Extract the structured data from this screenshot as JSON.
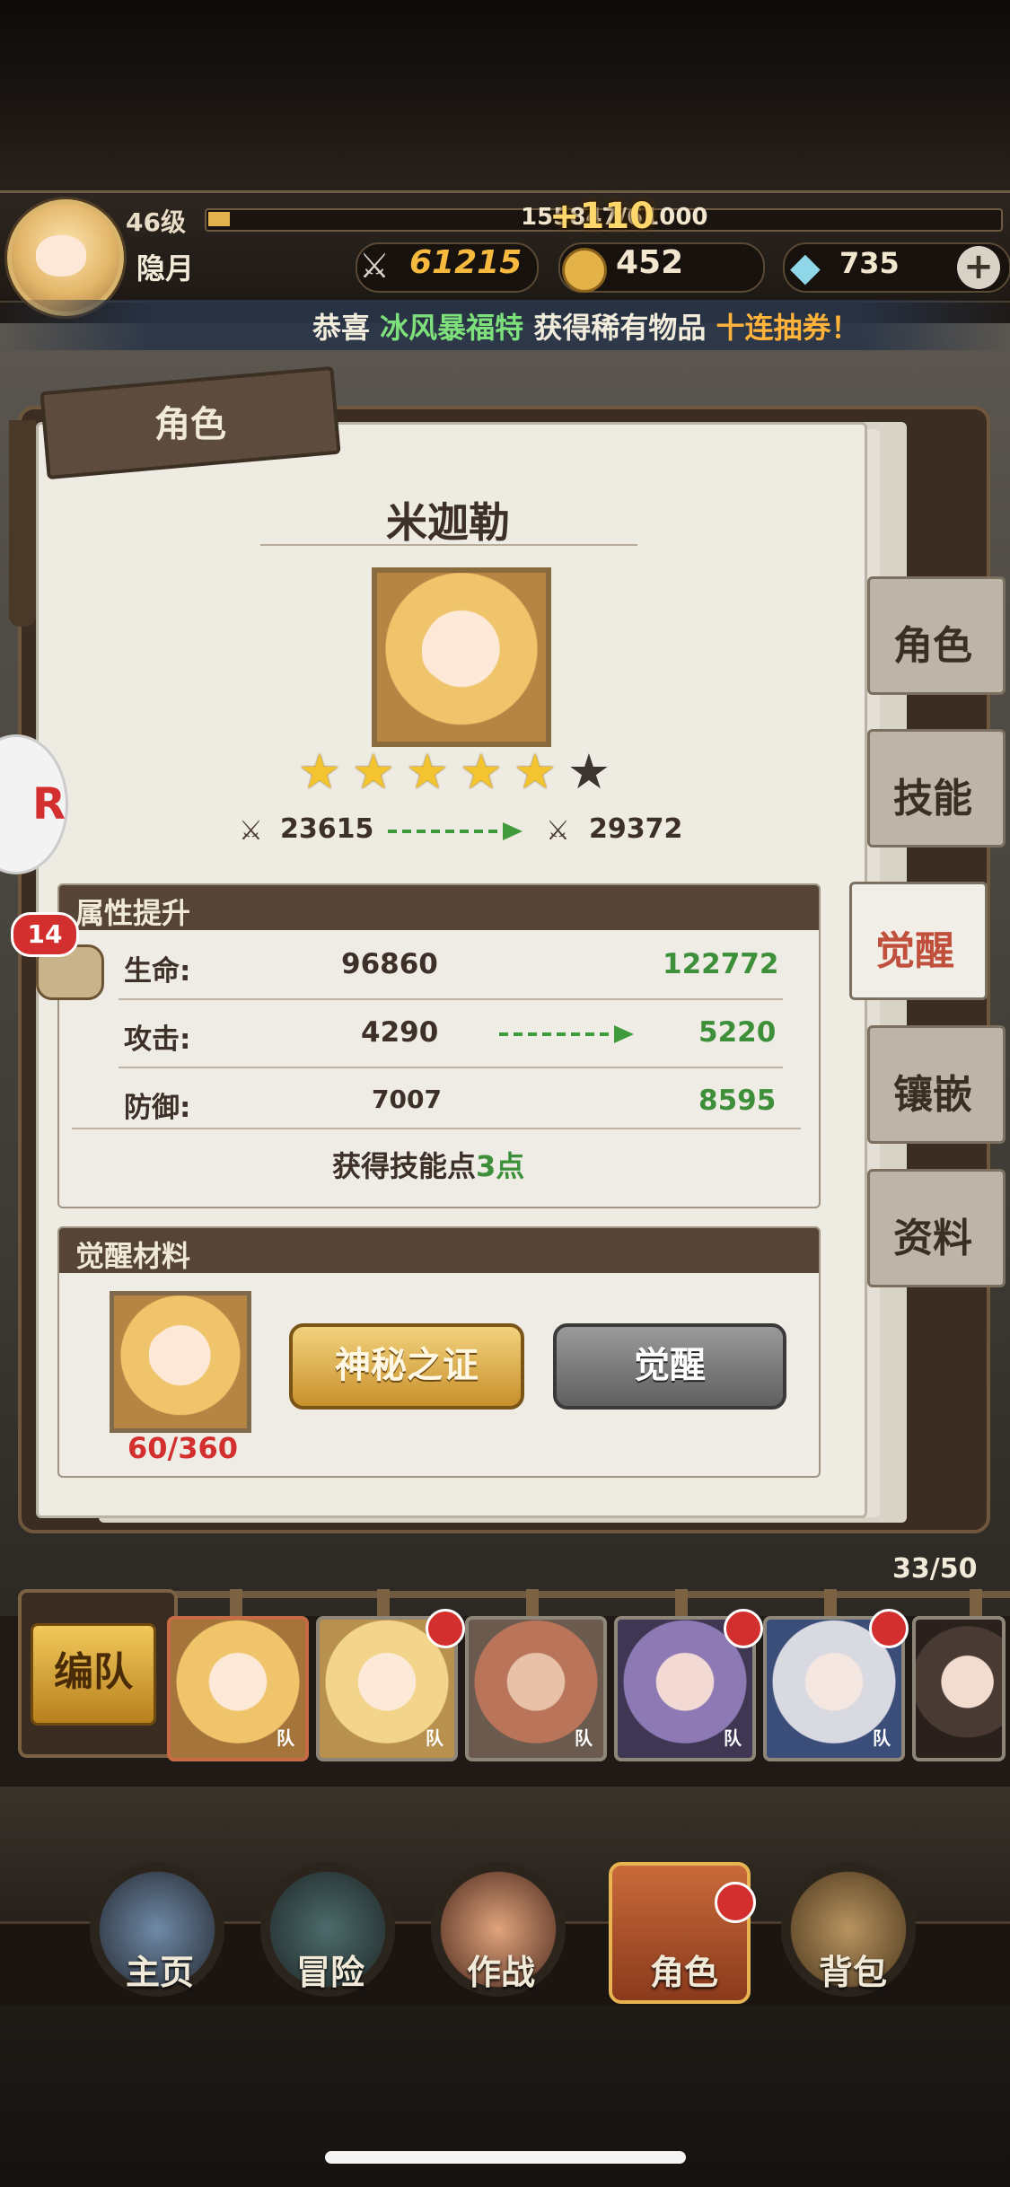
{
  "player": {
    "level": "46级",
    "exp": "155847/61000",
    "exp_gain": "+110",
    "name": "隐月",
    "power": "61215",
    "gold": "452",
    "gems": "735",
    "add": "+"
  },
  "news": {
    "prefix": "恭喜",
    "player": "冰风暴福特",
    "middle": "获得稀有物品",
    "item": "十连抽券",
    "suffix": "！"
  },
  "panel": {
    "title": "角色",
    "hero_name": "米迦勒",
    "stars_filled": 5,
    "stars_total": 6,
    "power_before": "23615",
    "power_after": "29372"
  },
  "attributes": {
    "header": "属性提升",
    "rows": [
      {
        "label": "生命:",
        "from": "96860",
        "to": "122772"
      },
      {
        "label": "攻击:",
        "from": "4290",
        "to": "5220"
      },
      {
        "label": "防御:",
        "from": "7007",
        "to": "8595"
      }
    ],
    "skill_prefix": "获得技能点",
    "skill_points": "3点"
  },
  "materials": {
    "header": "觉醒材料",
    "count": "60/360",
    "mystery_button": "神秘之证",
    "awaken_button": "觉醒"
  },
  "side_tabs": [
    "角色",
    "技能",
    "觉醒",
    "镶嵌",
    "资料"
  ],
  "active_tab": "觉醒",
  "chat_badge": "14",
  "team": {
    "count": "33/50",
    "button": "编队",
    "tag": "队"
  },
  "nav": [
    "主页",
    "冒险",
    "作战",
    "角色",
    "背包"
  ],
  "colors": {
    "accent_green": "#3d8f3a",
    "badge_red": "#d32f2f",
    "gold": "#f7b93e"
  }
}
